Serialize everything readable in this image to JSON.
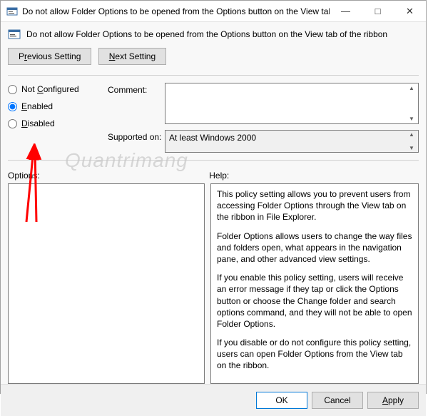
{
  "window": {
    "title": "Do not allow Folder Options to be opened from the Options button on the View tab of the ribbon"
  },
  "header": {
    "title": "Do not allow Folder Options to be opened from the Options button on the View tab of the ribbon"
  },
  "nav": {
    "previous_pre": "P",
    "previous_u": "r",
    "previous_post": "evious Setting",
    "next_u": "N",
    "next_post": "ext Setting"
  },
  "radios": {
    "not_configured_pre": "Not ",
    "not_configured_u": "C",
    "not_configured_post": "onfigured",
    "enabled_u": "E",
    "enabled_post": "nabled",
    "disabled_u": "D",
    "disabled_post": "isabled",
    "selected": "enabled"
  },
  "form": {
    "comment_label": "Comment:",
    "comment_value": "",
    "supported_label": "Supported on:",
    "supported_value": "At least Windows 2000"
  },
  "labels": {
    "options": "Options:",
    "help": "Help:"
  },
  "help": {
    "p1": "This policy setting allows you to prevent users from accessing Folder Options through the View tab on the ribbon in File Explorer.",
    "p2": "Folder Options allows users to change the way files and folders open, what appears in the navigation pane, and other advanced view settings.",
    "p3": "If you enable this policy setting, users will receive an error message if they tap or click the Options button or choose the Change folder and search options command, and they will not be able to open Folder Options.",
    "p4": "If you disable or do not configure this policy setting, users can open Folder Options from the View tab on the ribbon."
  },
  "footer": {
    "ok": "OK",
    "cancel": "Cancel",
    "apply_u": "A",
    "apply_post": "pply"
  },
  "watermark": "Quantrimang"
}
